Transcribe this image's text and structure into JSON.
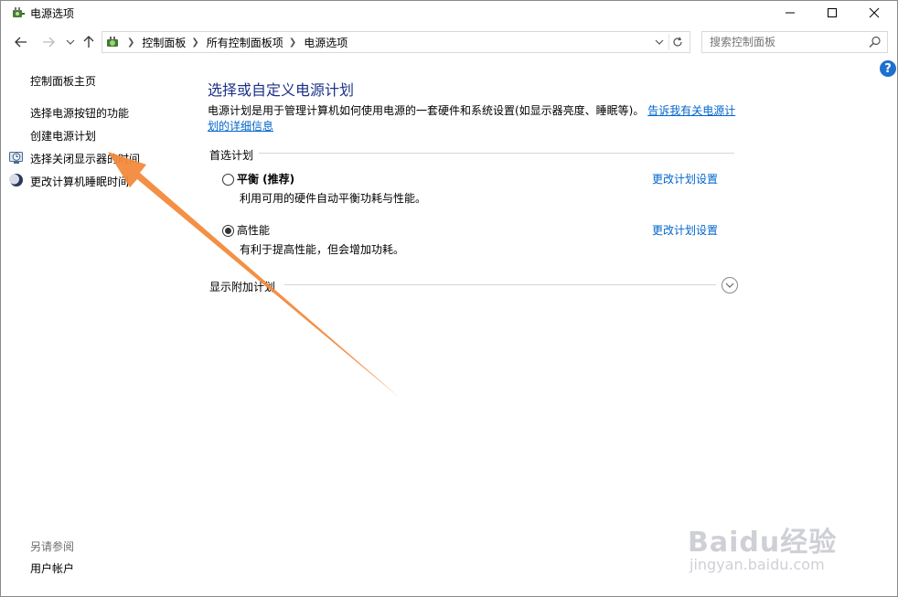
{
  "window": {
    "title": "电源选项"
  },
  "address": {
    "crumbs": [
      "控制面板",
      "所有控制面板项",
      "电源选项"
    ]
  },
  "search": {
    "placeholder": "搜索控制面板"
  },
  "help": {
    "label": "?"
  },
  "sidebar": {
    "items": [
      {
        "label": "控制面板主页"
      },
      {
        "label": "选择电源按钮的功能"
      },
      {
        "label": "创建电源计划"
      },
      {
        "label": "选择关闭显示器的时间",
        "icon": "clock-monitor-icon"
      },
      {
        "label": "更改计算机睡眠时间",
        "icon": "moon-icon"
      }
    ],
    "see_also": "另请参阅",
    "see_also_items": [
      {
        "label": "用户帐户"
      }
    ]
  },
  "main": {
    "heading": "选择或自定义电源计划",
    "description": "电源计划是用于管理计算机如何使用电源的一套硬件和系统设置(如显示器亮度、睡眠等)。",
    "description_link": "告诉我有关电源计划的详细信息",
    "preferred_group": "首选计划",
    "plans": [
      {
        "name": "平衡 (推荐)",
        "desc": "利用可用的硬件自动平衡功耗与性能。",
        "selected": false,
        "link": "更改计划设置"
      },
      {
        "name": "高性能",
        "desc": "有利于提高性能，但会增加功耗。",
        "selected": true,
        "link": "更改计划设置"
      }
    ],
    "show_more": "显示附加计划"
  },
  "watermark": {
    "main": "Baidu经验",
    "sub": "jingyan.baidu.com"
  },
  "colors": {
    "accent": "#1e3287",
    "link": "#0066cc",
    "annotation_arrow": "#f28a3b"
  }
}
